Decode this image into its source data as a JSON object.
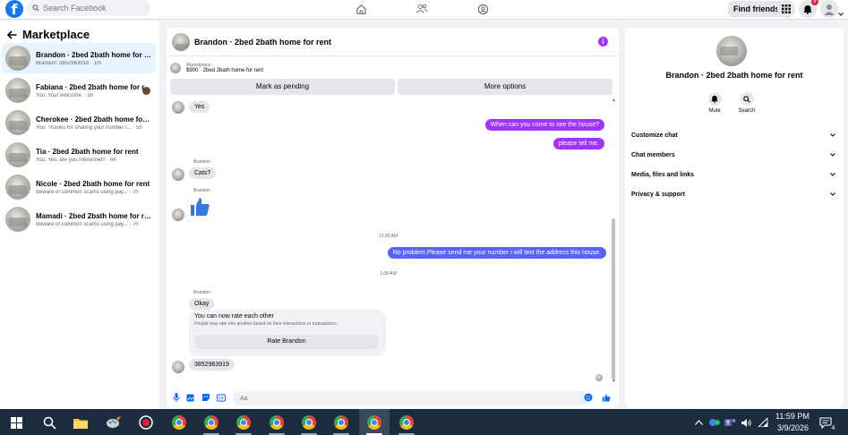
{
  "topbar": {
    "search_placeholder": "Search Facebook",
    "find_friends": "Find friends",
    "notification_count": "4"
  },
  "left": {
    "title": "Marketplace",
    "conversations": [
      {
        "name": "Brandon · 2bed 2bath home for rent",
        "sub": "Brandon: 3852963919 · 1m"
      },
      {
        "name": "Fabiana · 2bed 2bath home for r...",
        "sub": "You: Your welcome. · 5h"
      },
      {
        "name": "Cherokee · 2bed 2bath home for r...",
        "sub": "You: Thanks for sharing your number I... · 5h"
      },
      {
        "name": "Tia · 2bed 2bath home for rent",
        "sub": "You: Yes, are you interested? · 6h"
      },
      {
        "name": "Nicole · 2bed 2bath home for rent",
        "sub": "Beware of common scams using pay... · 7h"
      },
      {
        "name": "Mamadi · 2bed 2bath home for rent",
        "sub": "Beware of common scams using pay... · 7h"
      }
    ]
  },
  "chat": {
    "header_name": "Brandon · 2bed 2bath home for rent",
    "listing_label": "Marketplace",
    "listing_title": "$900 · 2bed 2bath home for rent",
    "mark_pending": "Mark as pending",
    "more_options": "More options",
    "messages": {
      "m1": "Yes",
      "m2": "When can you come to see the house?",
      "m3": "please tell me.",
      "sender1": "Brandon",
      "m4": "Cats?",
      "sender2": "Brandon",
      "time1": "12:30 AM",
      "m5": "No problem.Please send me your number i will text the address this house.",
      "time2": "1:08 AM",
      "sender3": "Brandon",
      "m6": "Okay",
      "rate_title": "You can now rate each other",
      "rate_sub": "People may rate one another based on their interactions or transactions.",
      "rate_btn": "Rate Brandon",
      "m7": "3852963919"
    },
    "composer_placeholder": "Aa"
  },
  "right": {
    "name": "Brandon · 2bed 2bath home for rent",
    "mute": "Mute",
    "search": "Search",
    "rows": [
      "Customize chat",
      "Chat members",
      "Media, files and links",
      "Privacy & support"
    ]
  },
  "taskbar": {
    "time": "11:59 PM",
    "date": "3/9/2026",
    "notification_count": "4"
  }
}
